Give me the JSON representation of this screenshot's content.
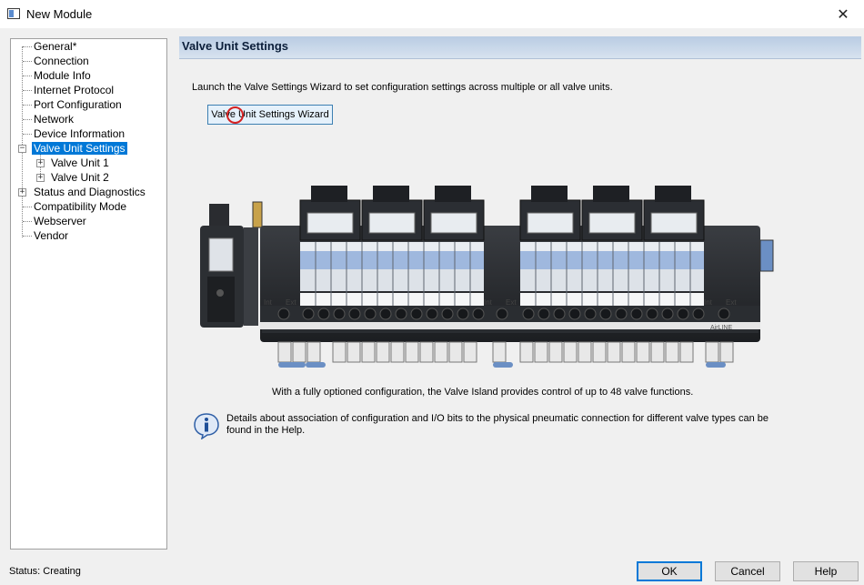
{
  "window": {
    "title": "New Module",
    "close_glyph": "✕"
  },
  "tree": {
    "items": [
      {
        "label": "General*"
      },
      {
        "label": "Connection"
      },
      {
        "label": "Module Info"
      },
      {
        "label": "Internet Protocol"
      },
      {
        "label": "Port Configuration"
      },
      {
        "label": "Network"
      },
      {
        "label": "Device Information"
      },
      {
        "label": "Valve Unit Settings",
        "selected": true,
        "expander": "−"
      },
      {
        "label": "Valve Unit 1",
        "expander": "+"
      },
      {
        "label": "Valve Unit 2",
        "expander": "+"
      },
      {
        "label": "Status and Diagnostics",
        "expander": "+"
      },
      {
        "label": "Compatibility Mode"
      },
      {
        "label": "Webserver"
      },
      {
        "label": "Vendor"
      }
    ]
  },
  "panel": {
    "header": "Valve Unit Settings",
    "intro": "Launch the Valve Settings Wizard to set configuration settings across multiple or all valve units.",
    "wizard_button": "Valve Unit Settings Wizard",
    "caption": "With a fully optioned configuration, the Valve Island provides control of up to 48 valve functions.",
    "info_text": "Details about association of configuration and I/O bits to the physical pneumatic connection for different valve types can be found in the Help.",
    "island_labels": {
      "int": "Int",
      "ext": "Ext",
      "brand": "AirLINE"
    }
  },
  "status": {
    "text": "Status:  Creating"
  },
  "buttons": {
    "ok": "OK",
    "cancel": "Cancel",
    "help": "Help"
  },
  "colors": {
    "selection": "#0078d7",
    "header_bg": "#c6d6ea",
    "valve_blue": "#9fb8de"
  }
}
